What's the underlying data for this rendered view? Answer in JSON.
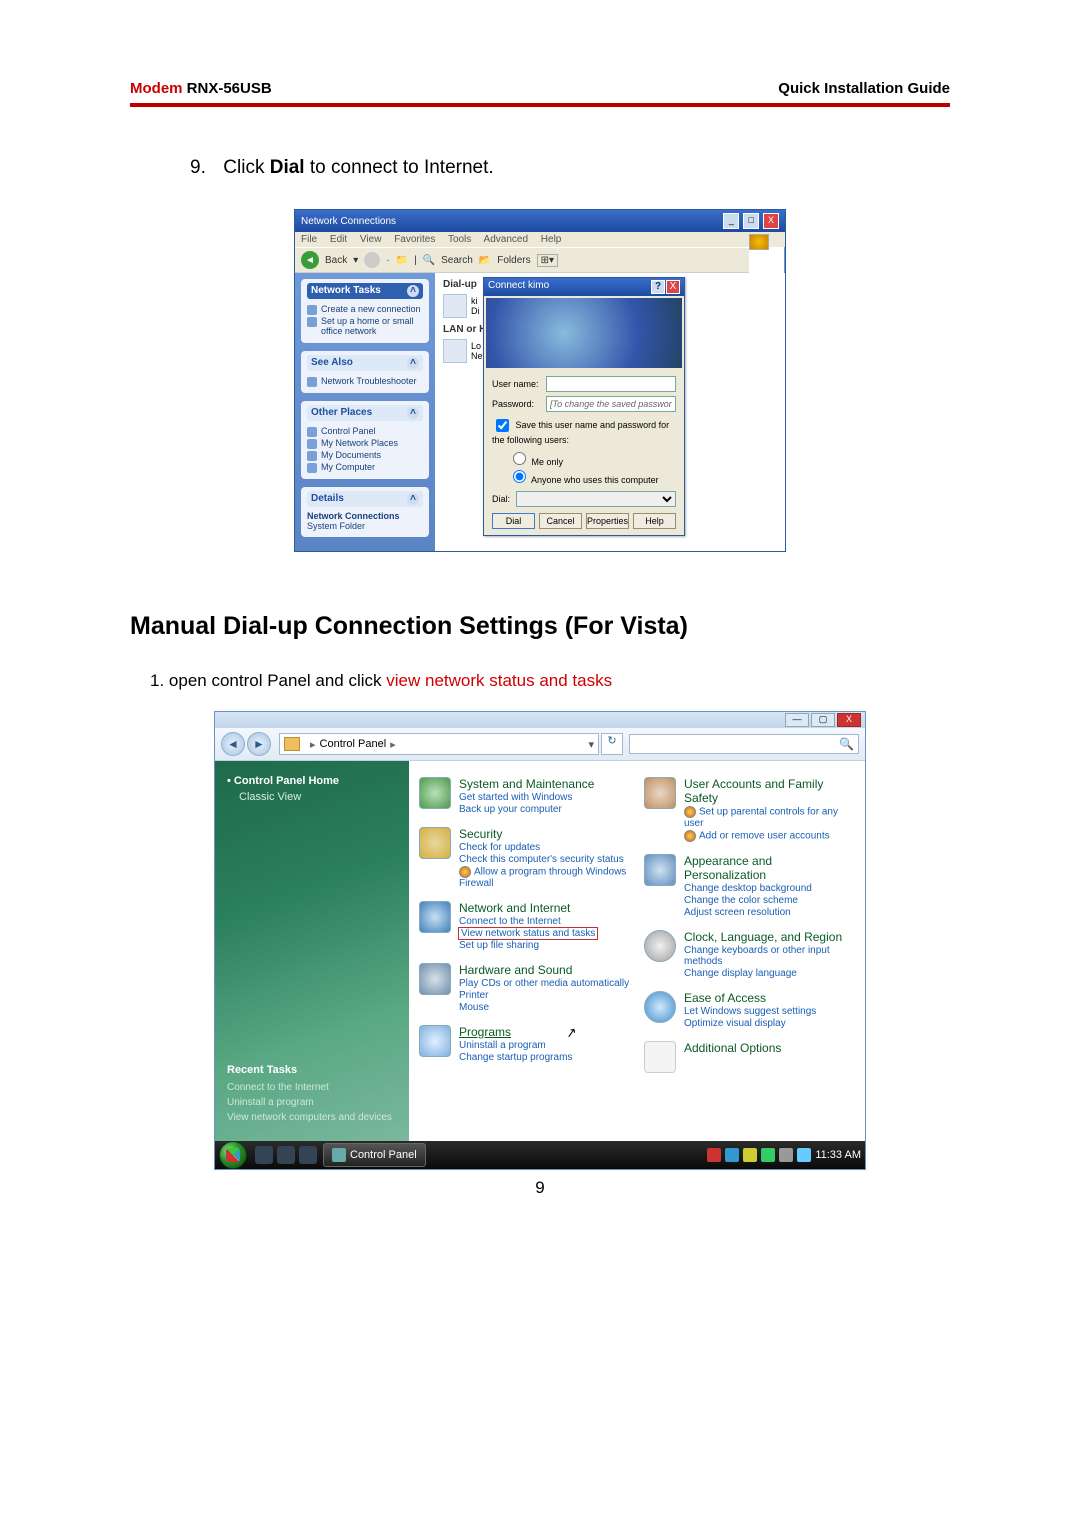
{
  "header": {
    "brand": "Modem",
    "model": "RNX-56USB",
    "right": "Quick  Installation  Guide"
  },
  "step9": {
    "num": "9.",
    "prefix": "Click ",
    "bold": "Dial",
    "suffix": " to connect to Internet."
  },
  "xp": {
    "title": "Network Connections",
    "menu": [
      "File",
      "Edit",
      "View",
      "Favorites",
      "Tools",
      "Advanced",
      "Help"
    ],
    "toolbar": {
      "back": "Back",
      "search": "Search",
      "folders": "Folders"
    },
    "side_tasks": {
      "title": "Network Tasks",
      "items": [
        "Create a new connection",
        "Set up a home or small office network"
      ]
    },
    "side_seealso": {
      "title": "See Also",
      "items": [
        "Network Troubleshooter"
      ]
    },
    "side_other": {
      "title": "Other Places",
      "items": [
        "Control Panel",
        "My Network Places",
        "My Documents",
        "My Computer"
      ]
    },
    "side_details": {
      "title": "Details",
      "line1": "Network Connections",
      "line2": "System Folder"
    },
    "main": {
      "cat1": "Dial-up",
      "cat2": "LAN or High-"
    },
    "dialog": {
      "title": "Connect kimo",
      "user_label": "User name:",
      "pass_label": "Password:",
      "pass_placeholder": "[To change the saved password, click here]",
      "save_check": "Save this user name and password for the following users:",
      "radio_me": "Me only",
      "radio_any": "Anyone who uses this computer",
      "dial_label": "Dial:",
      "btn_dial": "Dial",
      "btn_cancel": "Cancel",
      "btn_props": "Properties",
      "btn_help": "Help"
    }
  },
  "section_heading": "Manual Dial-up Connection Settings (For Vista)",
  "vista_step": {
    "num": "1. ",
    "black": "open control Panel and click ",
    "red": "view network status and tasks"
  },
  "vista": {
    "breadcrumb": "Control Panel",
    "side": {
      "home": "Control Panel Home",
      "classic": "Classic View",
      "recent_title": "Recent Tasks",
      "recent": [
        "Connect to the Internet",
        "Uninstall a program",
        "View network computers and devices"
      ]
    },
    "left_col": [
      {
        "title": "System and Maintenance",
        "links": [
          "Get started with Windows",
          "Back up your computer"
        ]
      },
      {
        "title": "Security",
        "links": [
          "Check for updates",
          "Check this computer's security status",
          "Allow a program through Windows Firewall"
        ]
      },
      {
        "title": "Network and Internet",
        "links": [
          "Connect to the Internet",
          "View network status and tasks",
          "Set up file sharing"
        ]
      },
      {
        "title": "Hardware and Sound",
        "links": [
          "Play CDs or other media automatically",
          "Printer",
          "Mouse"
        ]
      },
      {
        "title": "Programs",
        "links": [
          "Uninstall a program",
          "Change startup programs"
        ]
      }
    ],
    "right_col": [
      {
        "title": "User Accounts and Family Safety",
        "links": [
          "Set up parental controls for any user",
          "Add or remove user accounts"
        ]
      },
      {
        "title": "Appearance and Personalization",
        "links": [
          "Change desktop background",
          "Change the color scheme",
          "Adjust screen resolution"
        ]
      },
      {
        "title": "Clock, Language, and Region",
        "links": [
          "Change keyboards or other input methods",
          "Change display language"
        ]
      },
      {
        "title": "Ease of Access",
        "links": [
          "Let Windows suggest settings",
          "Optimize visual display"
        ]
      },
      {
        "title": "Additional Options",
        "links": []
      }
    ],
    "taskbar": {
      "app": "Control Panel",
      "time": "11:33 AM"
    }
  },
  "page_num": "9"
}
